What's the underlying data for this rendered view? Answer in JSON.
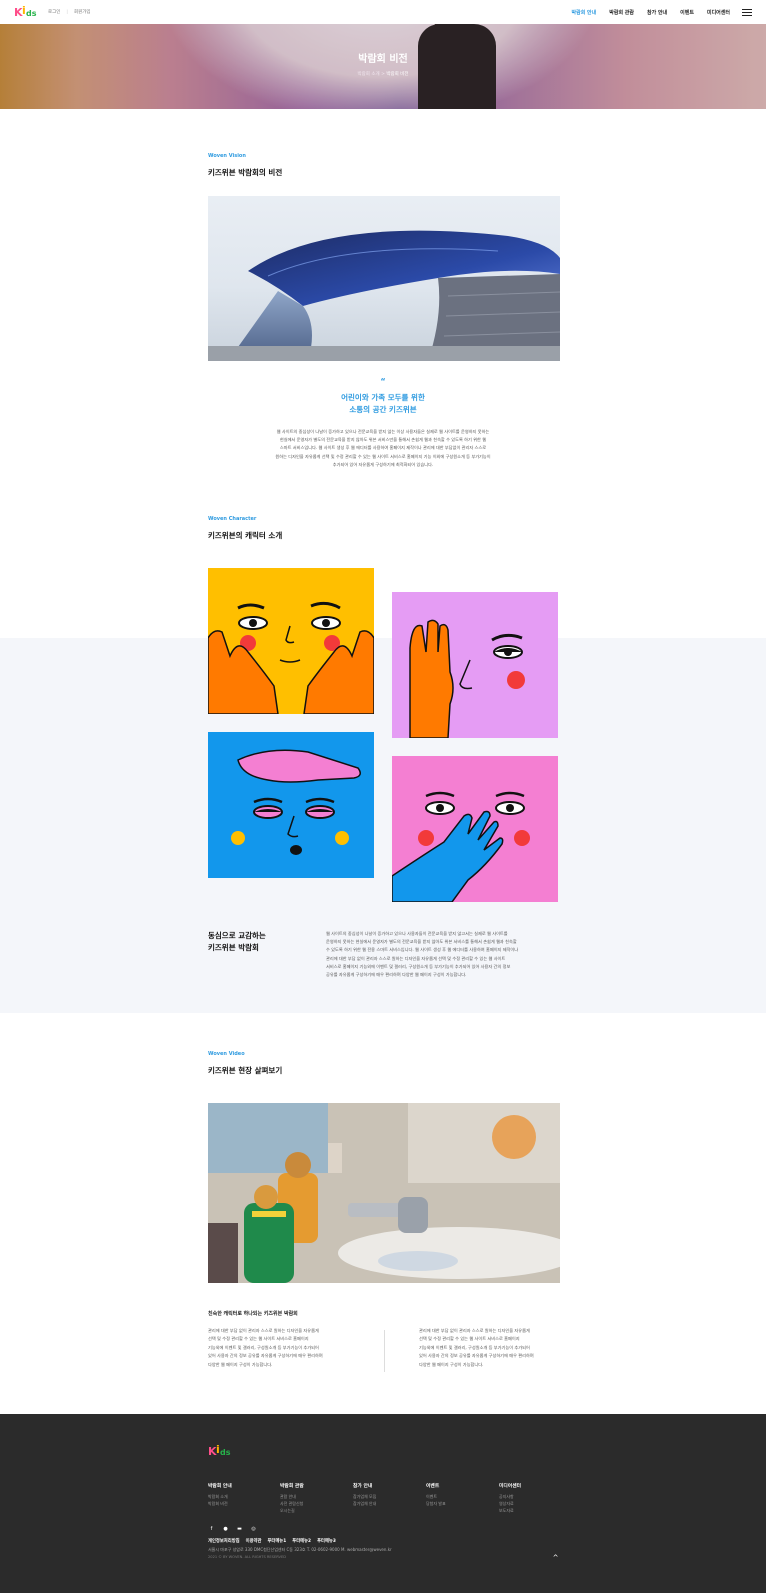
{
  "header": {
    "util": [
      "로그인",
      "회원가입"
    ],
    "nav": [
      "박람회 안내",
      "박람회 관람",
      "참가 안내",
      "이벤트",
      "미디어센터"
    ],
    "active_index": 0
  },
  "hero": {
    "title": "박람회 비전",
    "crumb_parent": "박람회 소개",
    "crumb_sep": ">",
    "crumb_current": "박람회 비전"
  },
  "vision": {
    "eyebrow": "Woven Vision",
    "title": "키즈위븐 박람회의 비전",
    "quote_mark": "“",
    "lead1": "어린이와 가족 모두를 위한",
    "lead2": "소통의 공간 키즈위븐",
    "body": [
      "웹 사이트의 중심성이 나날이 증가하고 있으나 전문교육을 받지 않는 이상 사용자들은 실제로 웹 사이트를 운영하지 못하는",
      "현실에서 운영자가 별도의 전문교육을 받지 않아도 위븐 서비스만을 통해서 손쉽게 웹과 친숙할 수 있도록 하기 위한 웹",
      "스마트 서비스입니다. 웹 사이트 생성 후 웹 에디터를 사용하여 홈페이지 제작이나 관리에 대한 부담없이 관리자 스스로",
      "원하는 디자인을 자유롭게 선택 및 수정 관리할 수 있는 웹 사이트 서비스로 홈페이지 기능 이외에 구성원소개 등 부가기능이",
      "추가되어 있어 자유롭게 구성하기에 최적화되어 있습니다."
    ]
  },
  "character": {
    "eyebrow": "Woven Character",
    "title": "키즈위븐의 캐릭터 소개",
    "side_title1": "동심으로 교감하는",
    "side_title2": "키즈위븐 박람회",
    "side_body": [
      "웹 사이트의 중심성이 나날이 증가하고 있으나 사용자들이 전문교육을 받지 않고서는 실제로 웹 사이트를",
      "운영하지 못하는 현실에서 운영자가 별도의 전문교육을 받지 않아도 위븐 서비스를 통해서 손쉽게 웹과 친숙할",
      "수 있도록 하기 위한 웹 전용 스마트 서비스입니다. 웹 사이트 생성 후 웹 에디터를 사용하여 홈페이지 제작이나",
      "관리에 대한 부담 없이 관리자 스스로 원하는 디자인을 자유롭게 선택 및 수정 관리할 수 있는 웹 사이트",
      "서비스로 홈페이지 기능외에 이벤트 및 갤러리, 구성원소개 등 부가기능이 추가되어 있어 사용자 간의 정보",
      "공유를 자유롭게 구성하기에 매우 편리하며 다양한 웹 페이지 구성이 가능합니다."
    ],
    "colors": {
      "yellow": "#ffbf00",
      "lilac": "#e59cf4",
      "blue": "#1297ec",
      "pink": "#f47fd2",
      "orange": "#ff7a00",
      "red": "#f23a3a"
    }
  },
  "video": {
    "eyebrow": "Woven Video",
    "title": "키즈위븐 현장 살펴보기",
    "subtitle": "친숙한 캐릭터로 하나되는 키즈위븐 박람회",
    "left": [
      "관리에 대한 부담 없이 관리자 스스로 원하는 디자인을 자유롭게",
      "선택 및 수정 관리할 수 있는 웹 사이트 서비스로 홈페이지",
      "기능외에 이벤트 및 갤러리, 구성원소개 등 부가기능이 추가되어",
      "있어 사용자 간의 정보 공유를 자유롭게 구성하기에 매우 편리하며",
      "다양한 웹 페이지 구성이 가능합니다."
    ],
    "right": [
      "관리에 대한 부담 없이 관리자 스스로 원하는 디자인을 자유롭게",
      "선택 및 수정 관리할 수 있는 웹 사이트 서비스로 홈페이지",
      "기능외에 이벤트 및 갤러리, 구성원소개 등 부가기능이 추가되어",
      "있어 사용자 간의 정보 공유를 자유롭게 구성하기에 매우 편리하며",
      "다양한 웹 페이지 구성이 가능합니다."
    ]
  },
  "footer": {
    "columns": [
      {
        "title": "박람회 안내",
        "items": [
          "박람회 소개",
          "박람회 비전"
        ]
      },
      {
        "title": "박람회 관람",
        "items": [
          "관람 안내",
          "사전 관람신청",
          "오시는길"
        ]
      },
      {
        "title": "참가 안내",
        "items": [
          "참가업체 모집",
          "참가업체 안내"
        ]
      },
      {
        "title": "이벤트",
        "items": [
          "이벤트",
          "당첨자 발표"
        ]
      },
      {
        "title": "미디어센터",
        "items": [
          "공지사항",
          "영상자료",
          "보도자료"
        ]
      }
    ],
    "links": [
      "개인정보처리방침",
      "이용약관",
      "푸터메뉴1",
      "푸터메뉴2",
      "푸터메뉴3"
    ],
    "address": "서울시 마포구 성암로 330 DMC첨단산업센터 C동 323호   T. 02-0602-9000  M. webmaster@weven.kr",
    "copyright": "2021 © BY WOVEN. ALL RIGHTS RESERVED",
    "top_label": "^"
  }
}
